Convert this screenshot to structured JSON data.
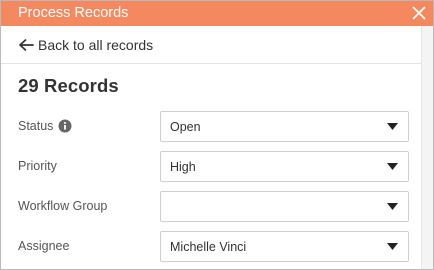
{
  "dialog": {
    "title": "Process Records",
    "accent_color": "#f4895f"
  },
  "back_link": {
    "label": "Back to all records",
    "icon": "arrow-left-icon"
  },
  "records_heading": "29 Records",
  "fields": [
    {
      "label": "Status",
      "value": "Open",
      "has_info_icon": true
    },
    {
      "label": "Priority",
      "value": "High"
    },
    {
      "label": "Workflow Group",
      "value": ""
    },
    {
      "label": "Assignee",
      "value": "Michelle Vinci"
    }
  ]
}
